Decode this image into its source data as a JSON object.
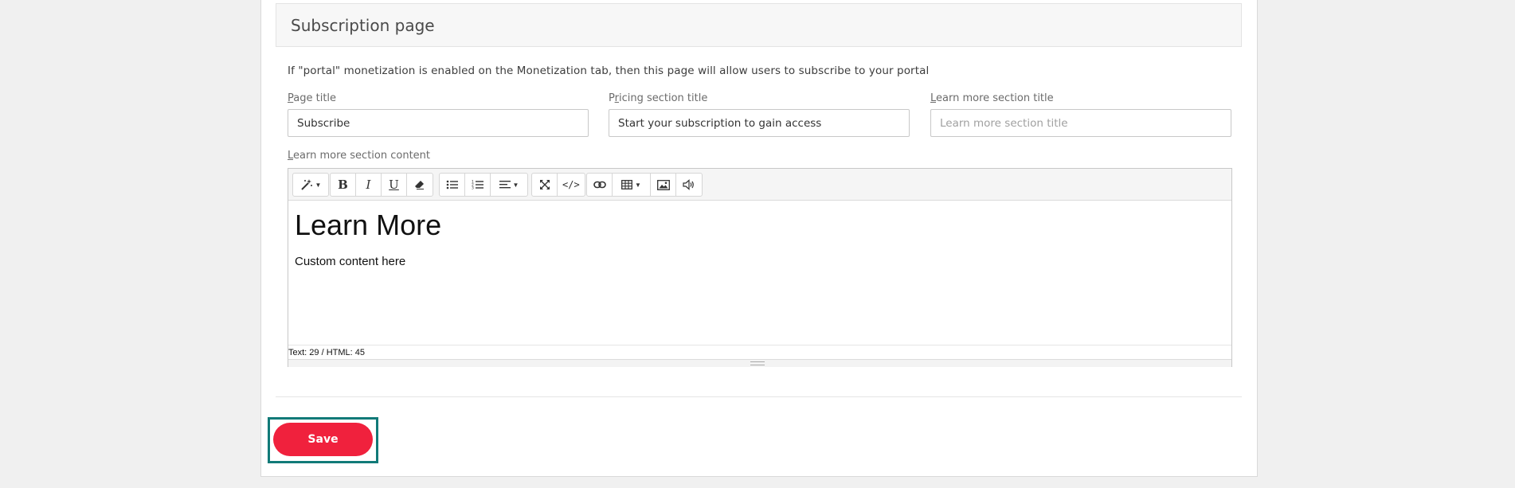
{
  "section": {
    "title": "Subscription page",
    "description": "If \"portal\" monetization is enabled on the Monetization tab, then this page will allow users to subscribe to your portal"
  },
  "fields": {
    "page_title": {
      "label_first": "P",
      "label_rest": "age title",
      "value": "Subscribe",
      "placeholder": ""
    },
    "pricing_title": {
      "label_first": "P",
      "label_u": "r",
      "label_rest": "icing section title",
      "value": "Start your subscription to gain access",
      "placeholder": ""
    },
    "learn_more_title": {
      "label_first": "L",
      "label_rest": "earn more section title",
      "value": "",
      "placeholder": "Learn more section title"
    }
  },
  "editor": {
    "label_first": "L",
    "label_rest": "earn more section content",
    "heading": "Learn More",
    "paragraph": "Custom content here",
    "status": "Text: 29 / HTML: 45",
    "toolbar_icons": [
      "magic-wand-icon",
      "bold-icon",
      "italic-icon",
      "underline-icon",
      "eraser-icon",
      "unordered-list-icon",
      "ordered-list-icon",
      "align-icon",
      "fullscreen-icon",
      "code-view-icon",
      "link-icon",
      "table-icon",
      "image-icon",
      "audio-icon"
    ]
  },
  "actions": {
    "save_label": "Save"
  },
  "colors": {
    "save_button": "#f0213d",
    "focus_ring": "#117a78"
  }
}
